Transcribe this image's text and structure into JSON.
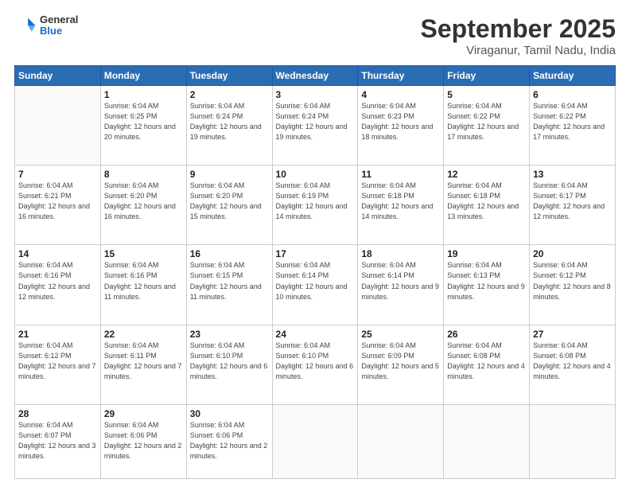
{
  "logo": {
    "general": "General",
    "blue": "Blue"
  },
  "header": {
    "month": "September 2025",
    "location": "Viraganur, Tamil Nadu, India"
  },
  "weekdays": [
    "Sunday",
    "Monday",
    "Tuesday",
    "Wednesday",
    "Thursday",
    "Friday",
    "Saturday"
  ],
  "weeks": [
    [
      {
        "day": "",
        "sunrise": "",
        "sunset": "",
        "daylight": ""
      },
      {
        "day": "1",
        "sunrise": "Sunrise: 6:04 AM",
        "sunset": "Sunset: 6:25 PM",
        "daylight": "Daylight: 12 hours and 20 minutes."
      },
      {
        "day": "2",
        "sunrise": "Sunrise: 6:04 AM",
        "sunset": "Sunset: 6:24 PM",
        "daylight": "Daylight: 12 hours and 19 minutes."
      },
      {
        "day": "3",
        "sunrise": "Sunrise: 6:04 AM",
        "sunset": "Sunset: 6:24 PM",
        "daylight": "Daylight: 12 hours and 19 minutes."
      },
      {
        "day": "4",
        "sunrise": "Sunrise: 6:04 AM",
        "sunset": "Sunset: 6:23 PM",
        "daylight": "Daylight: 12 hours and 18 minutes."
      },
      {
        "day": "5",
        "sunrise": "Sunrise: 6:04 AM",
        "sunset": "Sunset: 6:22 PM",
        "daylight": "Daylight: 12 hours and 17 minutes."
      },
      {
        "day": "6",
        "sunrise": "Sunrise: 6:04 AM",
        "sunset": "Sunset: 6:22 PM",
        "daylight": "Daylight: 12 hours and 17 minutes."
      }
    ],
    [
      {
        "day": "7",
        "sunrise": "Sunrise: 6:04 AM",
        "sunset": "Sunset: 6:21 PM",
        "daylight": "Daylight: 12 hours and 16 minutes."
      },
      {
        "day": "8",
        "sunrise": "Sunrise: 6:04 AM",
        "sunset": "Sunset: 6:20 PM",
        "daylight": "Daylight: 12 hours and 16 minutes."
      },
      {
        "day": "9",
        "sunrise": "Sunrise: 6:04 AM",
        "sunset": "Sunset: 6:20 PM",
        "daylight": "Daylight: 12 hours and 15 minutes."
      },
      {
        "day": "10",
        "sunrise": "Sunrise: 6:04 AM",
        "sunset": "Sunset: 6:19 PM",
        "daylight": "Daylight: 12 hours and 14 minutes."
      },
      {
        "day": "11",
        "sunrise": "Sunrise: 6:04 AM",
        "sunset": "Sunset: 6:18 PM",
        "daylight": "Daylight: 12 hours and 14 minutes."
      },
      {
        "day": "12",
        "sunrise": "Sunrise: 6:04 AM",
        "sunset": "Sunset: 6:18 PM",
        "daylight": "Daylight: 12 hours and 13 minutes."
      },
      {
        "day": "13",
        "sunrise": "Sunrise: 6:04 AM",
        "sunset": "Sunset: 6:17 PM",
        "daylight": "Daylight: 12 hours and 12 minutes."
      }
    ],
    [
      {
        "day": "14",
        "sunrise": "Sunrise: 6:04 AM",
        "sunset": "Sunset: 6:16 PM",
        "daylight": "Daylight: 12 hours and 12 minutes."
      },
      {
        "day": "15",
        "sunrise": "Sunrise: 6:04 AM",
        "sunset": "Sunset: 6:16 PM",
        "daylight": "Daylight: 12 hours and 11 minutes."
      },
      {
        "day": "16",
        "sunrise": "Sunrise: 6:04 AM",
        "sunset": "Sunset: 6:15 PM",
        "daylight": "Daylight: 12 hours and 11 minutes."
      },
      {
        "day": "17",
        "sunrise": "Sunrise: 6:04 AM",
        "sunset": "Sunset: 6:14 PM",
        "daylight": "Daylight: 12 hours and 10 minutes."
      },
      {
        "day": "18",
        "sunrise": "Sunrise: 6:04 AM",
        "sunset": "Sunset: 6:14 PM",
        "daylight": "Daylight: 12 hours and 9 minutes."
      },
      {
        "day": "19",
        "sunrise": "Sunrise: 6:04 AM",
        "sunset": "Sunset: 6:13 PM",
        "daylight": "Daylight: 12 hours and 9 minutes."
      },
      {
        "day": "20",
        "sunrise": "Sunrise: 6:04 AM",
        "sunset": "Sunset: 6:12 PM",
        "daylight": "Daylight: 12 hours and 8 minutes."
      }
    ],
    [
      {
        "day": "21",
        "sunrise": "Sunrise: 6:04 AM",
        "sunset": "Sunset: 6:12 PM",
        "daylight": "Daylight: 12 hours and 7 minutes."
      },
      {
        "day": "22",
        "sunrise": "Sunrise: 6:04 AM",
        "sunset": "Sunset: 6:11 PM",
        "daylight": "Daylight: 12 hours and 7 minutes."
      },
      {
        "day": "23",
        "sunrise": "Sunrise: 6:04 AM",
        "sunset": "Sunset: 6:10 PM",
        "daylight": "Daylight: 12 hours and 6 minutes."
      },
      {
        "day": "24",
        "sunrise": "Sunrise: 6:04 AM",
        "sunset": "Sunset: 6:10 PM",
        "daylight": "Daylight: 12 hours and 6 minutes."
      },
      {
        "day": "25",
        "sunrise": "Sunrise: 6:04 AM",
        "sunset": "Sunset: 6:09 PM",
        "daylight": "Daylight: 12 hours and 5 minutes."
      },
      {
        "day": "26",
        "sunrise": "Sunrise: 6:04 AM",
        "sunset": "Sunset: 6:08 PM",
        "daylight": "Daylight: 12 hours and 4 minutes."
      },
      {
        "day": "27",
        "sunrise": "Sunrise: 6:04 AM",
        "sunset": "Sunset: 6:08 PM",
        "daylight": "Daylight: 12 hours and 4 minutes."
      }
    ],
    [
      {
        "day": "28",
        "sunrise": "Sunrise: 6:04 AM",
        "sunset": "Sunset: 6:07 PM",
        "daylight": "Daylight: 12 hours and 3 minutes."
      },
      {
        "day": "29",
        "sunrise": "Sunrise: 6:04 AM",
        "sunset": "Sunset: 6:06 PM",
        "daylight": "Daylight: 12 hours and 2 minutes."
      },
      {
        "day": "30",
        "sunrise": "Sunrise: 6:04 AM",
        "sunset": "Sunset: 6:06 PM",
        "daylight": "Daylight: 12 hours and 2 minutes."
      },
      {
        "day": "",
        "sunrise": "",
        "sunset": "",
        "daylight": ""
      },
      {
        "day": "",
        "sunrise": "",
        "sunset": "",
        "daylight": ""
      },
      {
        "day": "",
        "sunrise": "",
        "sunset": "",
        "daylight": ""
      },
      {
        "day": "",
        "sunrise": "",
        "sunset": "",
        "daylight": ""
      }
    ]
  ]
}
